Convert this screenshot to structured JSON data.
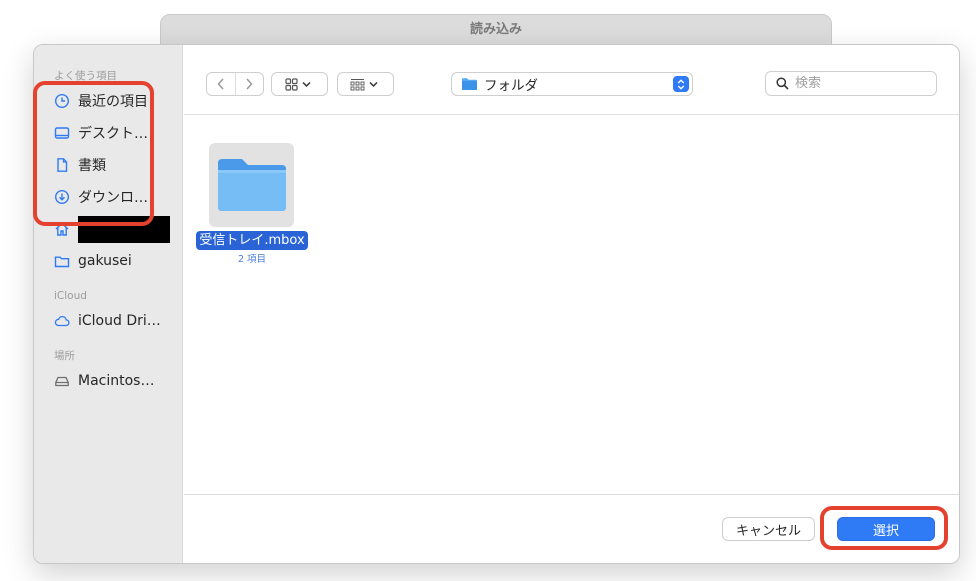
{
  "parent_window": {
    "title": "読み込み"
  },
  "sidebar": {
    "sections": [
      {
        "label": "よく使う項目",
        "items": [
          {
            "label": "最近の項目",
            "icon": "clock-icon"
          },
          {
            "label": "デスクト…",
            "icon": "desktop-icon"
          },
          {
            "label": "書類",
            "icon": "document-icon"
          },
          {
            "label": "ダウンロ…",
            "icon": "download-icon"
          },
          {
            "label": "",
            "icon": "home-icon"
          },
          {
            "label": "gakusei",
            "icon": "folder-icon"
          }
        ]
      },
      {
        "label": "iCloud",
        "items": [
          {
            "label": "iCloud Dri…",
            "icon": "cloud-icon"
          }
        ]
      },
      {
        "label": "場所",
        "items": [
          {
            "label": "Macintos…",
            "icon": "disk-icon"
          }
        ]
      }
    ]
  },
  "toolbar": {
    "folder_popup": {
      "label": "フォルダ"
    },
    "search": {
      "placeholder": "検索"
    }
  },
  "content": {
    "items": [
      {
        "name": "受信トレイ.mbox",
        "detail": "2 項目",
        "selected": true
      }
    ]
  },
  "footer": {
    "cancel_label": "キャンセル",
    "choose_label": "選択"
  },
  "colors": {
    "accent": "#2f7bf5",
    "annotation": "#e5412f",
    "selection": "#2a63d6"
  }
}
